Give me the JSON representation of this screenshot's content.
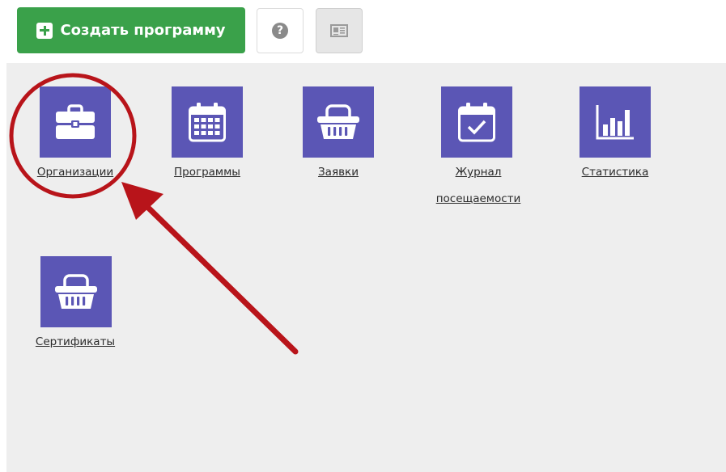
{
  "toolbar": {
    "create_label": "Создать программу",
    "create_icon": "plus-square-icon",
    "help_icon": "question-circle-icon",
    "news_icon": "newspaper-icon"
  },
  "tiles": [
    {
      "label": "Организации",
      "icon": "briefcase-icon"
    },
    {
      "label": "Программы",
      "icon": "calendar-grid-icon"
    },
    {
      "label": "Заявки",
      "icon": "basket-icon"
    },
    {
      "label": "Журнал",
      "label2": "посещаемости",
      "icon": "calendar-check-icon"
    },
    {
      "label": "Статистика",
      "icon": "bar-chart-icon"
    },
    {
      "label": "Сертификаты",
      "icon": "basket-icon"
    }
  ],
  "colors": {
    "create_button": "#3aa14a",
    "tile_background": "#5b56b5",
    "panel_background": "#eeeeee",
    "annotation": "#b8141a"
  }
}
